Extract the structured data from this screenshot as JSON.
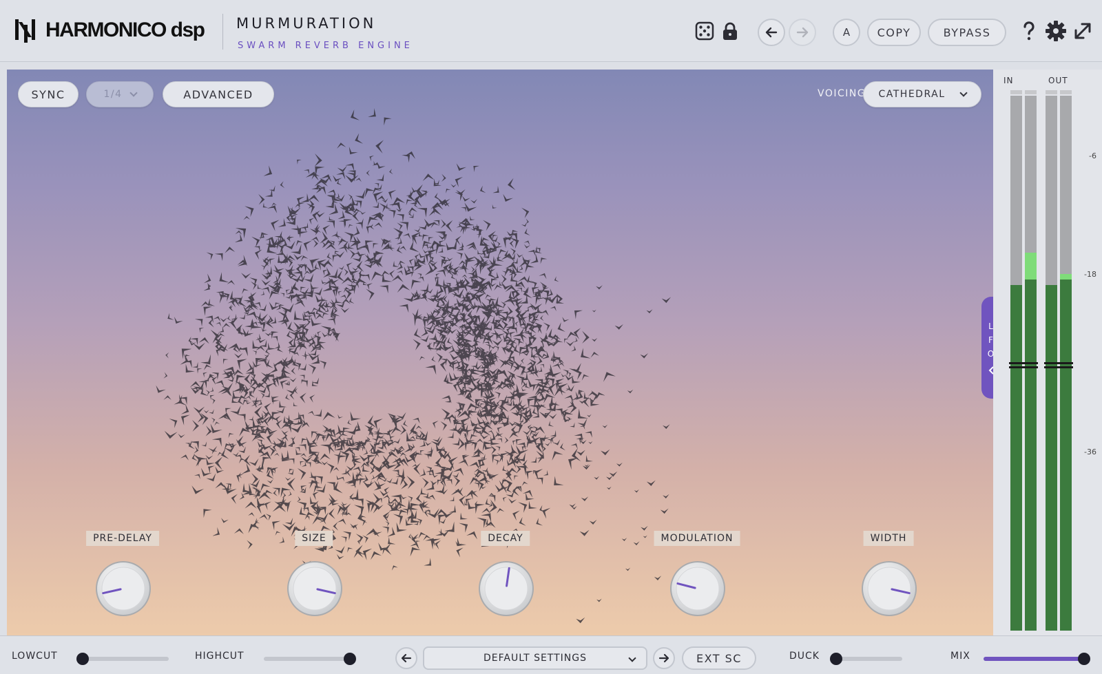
{
  "header": {
    "brand": "HARMONICO",
    "brand_suffix": "dsp",
    "product_title": "MURMURATION",
    "product_subtitle": "SWARM REVERB ENGINE",
    "ab_label": "A",
    "copy_label": "COPY",
    "bypass_label": "BYPASS",
    "icons": [
      "dice-icon",
      "lock-icon",
      "undo-arrow-icon",
      "redo-arrow-icon",
      "help-icon",
      "gear-icon",
      "expand-icon"
    ]
  },
  "display": {
    "sync_label": "SYNC",
    "division_value": "1/4",
    "advanced_label": "ADVANCED",
    "voicing_label": "VOICING",
    "voicing_value": "CATHEDRAL",
    "lfo_tab": [
      "L",
      "F",
      "O"
    ]
  },
  "knobs": [
    {
      "label": "PRE-DELAY",
      "value": 0.12
    },
    {
      "label": "SIZE",
      "value": 0.88
    },
    {
      "label": "DECAY",
      "value": 0.53
    },
    {
      "label": "MODULATION",
      "value": 0.22
    },
    {
      "label": "WIDTH",
      "value": 0.88
    }
  ],
  "meter": {
    "in_label": "IN",
    "out_label": "OUT",
    "db_labels": [
      "-6",
      "-18",
      "-36"
    ],
    "channels": [
      {
        "level": 0.64,
        "peak": 0.64
      },
      {
        "level": 0.65,
        "peak": 0.7
      },
      {
        "level": 0.64,
        "peak": 0.64
      },
      {
        "level": 0.65,
        "peak": 0.66
      }
    ]
  },
  "footer": {
    "lowcut_label": "LOWCUT",
    "lowcut_value": 0.0,
    "highcut_label": "HIGHCUT",
    "highcut_value": 1.0,
    "preset_name": "DEFAULT SETTINGS",
    "extsc_label": "EXT SC",
    "duck_label": "DUCK",
    "duck_value": 0.0,
    "mix_label": "MIX",
    "mix_value": 1.0
  },
  "colors": {
    "accent": "#7054bf",
    "meter_green": "#3c7b3e",
    "meter_peak": "#7fdc79"
  }
}
